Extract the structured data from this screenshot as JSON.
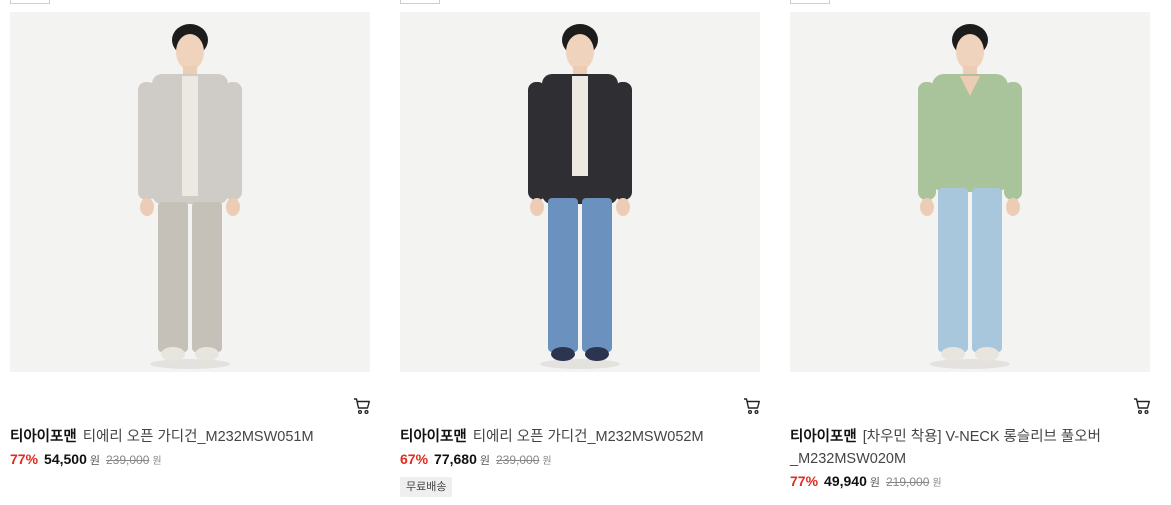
{
  "products": [
    {
      "brand": "티아이포맨",
      "name": "티에리 오픈 가디건_M232MSW051M",
      "discount": "77%",
      "price": "54,500",
      "price_unit": "원",
      "original_price": "239,000",
      "original_unit": "원",
      "badge": "",
      "colors": {
        "top": "#cfccc7",
        "bottom": "#c5c1b8",
        "shoes": "#e8e4de",
        "inner": "#ece9e2"
      }
    },
    {
      "brand": "티아이포맨",
      "name": "티에리 오픈 가디건_M232MSW052M",
      "discount": "67%",
      "price": "77,680",
      "price_unit": "원",
      "original_price": "239,000",
      "original_unit": "원",
      "badge": "무료배송",
      "colors": {
        "top": "#2f2e33",
        "bottom": "#6b91be",
        "shoes": "#2b3550",
        "inner": "#ece9e2"
      }
    },
    {
      "brand": "티아이포맨",
      "name": "[차우민 착용] V-NECK 롱슬리브 풀오버_M232MSW020M",
      "discount": "77%",
      "price": "49,940",
      "price_unit": "원",
      "original_price": "219,000",
      "original_unit": "원",
      "badge": "",
      "colors": {
        "top": "#a9c39a",
        "bottom": "#a9c7dc",
        "shoes": "#e8e4de",
        "inner": "#a9c39a"
      }
    }
  ],
  "icons": {
    "cart": "cart-icon"
  }
}
